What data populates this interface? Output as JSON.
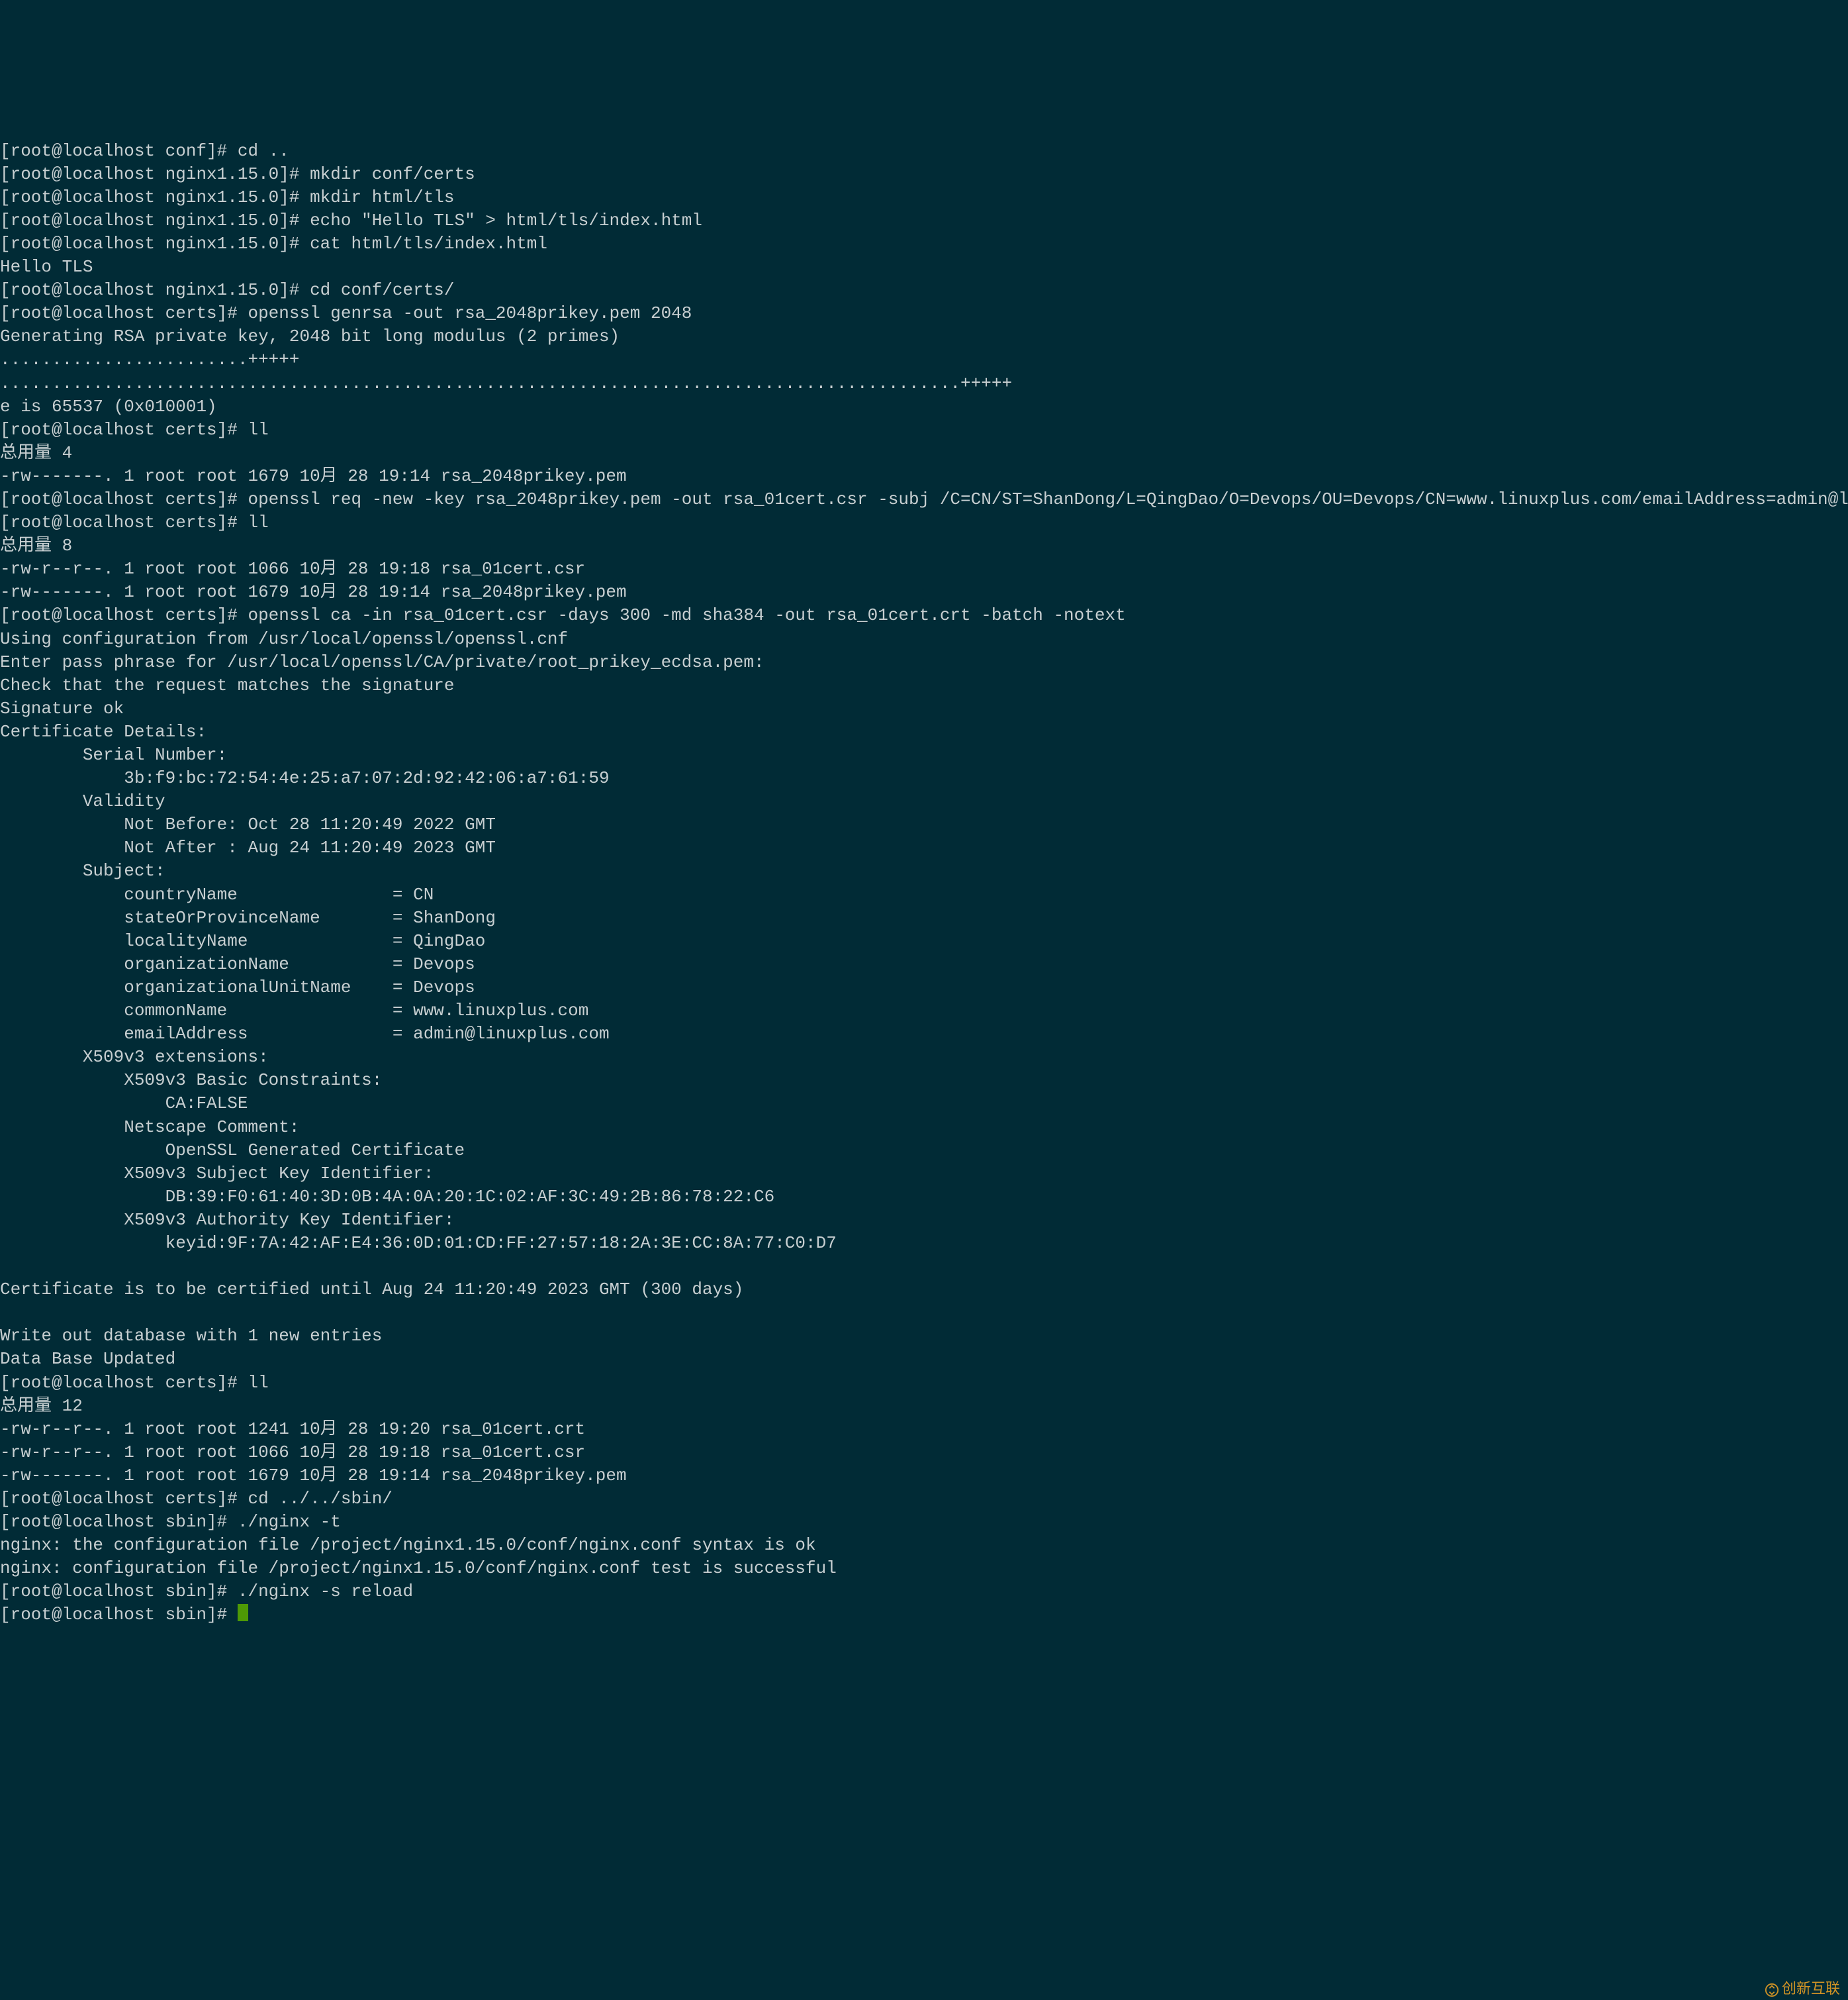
{
  "lines": {
    "l00": "[root@localhost conf]# cd ..",
    "l01": "[root@localhost nginx1.15.0]# mkdir conf/certs",
    "l02": "[root@localhost nginx1.15.0]# mkdir html/tls",
    "l03": "[root@localhost nginx1.15.0]# echo \"Hello TLS\" > html/tls/index.html",
    "l04": "[root@localhost nginx1.15.0]# cat html/tls/index.html",
    "l05": "Hello TLS",
    "l06": "[root@localhost nginx1.15.0]# cd conf/certs/",
    "l07": "[root@localhost certs]# openssl genrsa -out rsa_2048prikey.pem 2048",
    "l08": "Generating RSA private key, 2048 bit long modulus (2 primes)",
    "l09": "........................+++++",
    "l10": ".............................................................................................+++++",
    "l11": "e is 65537 (0x010001)",
    "l12": "[root@localhost certs]# ll",
    "l13": "总用量 4",
    "l14": "-rw-------. 1 root root 1679 10月 28 19:14 rsa_2048prikey.pem",
    "l15": "[root@localhost certs]# openssl req -new -key rsa_2048prikey.pem -out rsa_01cert.csr -subj /C=CN/ST=ShanDong/L=QingDao/O=Devops/OU=Devops/CN=www.linuxplus.com/emailAddress=admin@linuxplus.com",
    "l16": "[root@localhost certs]# ll",
    "l17": "总用量 8",
    "l18": "-rw-r--r--. 1 root root 1066 10月 28 19:18 rsa_01cert.csr",
    "l19": "-rw-------. 1 root root 1679 10月 28 19:14 rsa_2048prikey.pem",
    "l20": "[root@localhost certs]# openssl ca -in rsa_01cert.csr -days 300 -md sha384 -out rsa_01cert.crt -batch -notext",
    "l21": "Using configuration from /usr/local/openssl/openssl.cnf",
    "l22": "Enter pass phrase for /usr/local/openssl/CA/private/root_prikey_ecdsa.pem:",
    "l23": "Check that the request matches the signature",
    "l24": "Signature ok",
    "l25": "Certificate Details:",
    "l26": "        Serial Number:",
    "l27": "            3b:f9:bc:72:54:4e:25:a7:07:2d:92:42:06:a7:61:59",
    "l28": "        Validity",
    "l29": "            Not Before: Oct 28 11:20:49 2022 GMT",
    "l30": "            Not After : Aug 24 11:20:49 2023 GMT",
    "l31": "        Subject:",
    "l32": "            countryName               = CN",
    "l33": "            stateOrProvinceName       = ShanDong",
    "l34": "            localityName              = QingDao",
    "l35": "            organizationName          = Devops",
    "l36": "            organizationalUnitName    = Devops",
    "l37": "            commonName                = www.linuxplus.com",
    "l38": "            emailAddress              = admin@linuxplus.com",
    "l39": "        X509v3 extensions:",
    "l40": "            X509v3 Basic Constraints: ",
    "l41": "                CA:FALSE",
    "l42": "            Netscape Comment: ",
    "l43": "                OpenSSL Generated Certificate",
    "l44": "            X509v3 Subject Key Identifier: ",
    "l45": "                DB:39:F0:61:40:3D:0B:4A:0A:20:1C:02:AF:3C:49:2B:86:78:22:C6",
    "l46": "            X509v3 Authority Key Identifier: ",
    "l47": "                keyid:9F:7A:42:AF:E4:36:0D:01:CD:FF:27:57:18:2A:3E:CC:8A:77:C0:D7",
    "l48": "",
    "l49": "Certificate is to be certified until Aug 24 11:20:49 2023 GMT (300 days)",
    "l50": "",
    "l51": "Write out database with 1 new entries",
    "l52": "Data Base Updated",
    "l53": "[root@localhost certs]# ll",
    "l54": "总用量 12",
    "l55": "-rw-r--r--. 1 root root 1241 10月 28 19:20 rsa_01cert.crt",
    "l56": "-rw-r--r--. 1 root root 1066 10月 28 19:18 rsa_01cert.csr",
    "l57": "-rw-------. 1 root root 1679 10月 28 19:14 rsa_2048prikey.pem",
    "l58": "[root@localhost certs]# cd ../../sbin/",
    "l59": "[root@localhost sbin]# ./nginx -t",
    "l60": "nginx: the configuration file /project/nginx1.15.0/conf/nginx.conf syntax is ok",
    "l61": "nginx: configuration file /project/nginx1.15.0/conf/nginx.conf test is successful",
    "l62": "[root@localhost sbin]# ./nginx -s reload",
    "l63": "[root@localhost sbin]# "
  },
  "watermark": "创新互联"
}
